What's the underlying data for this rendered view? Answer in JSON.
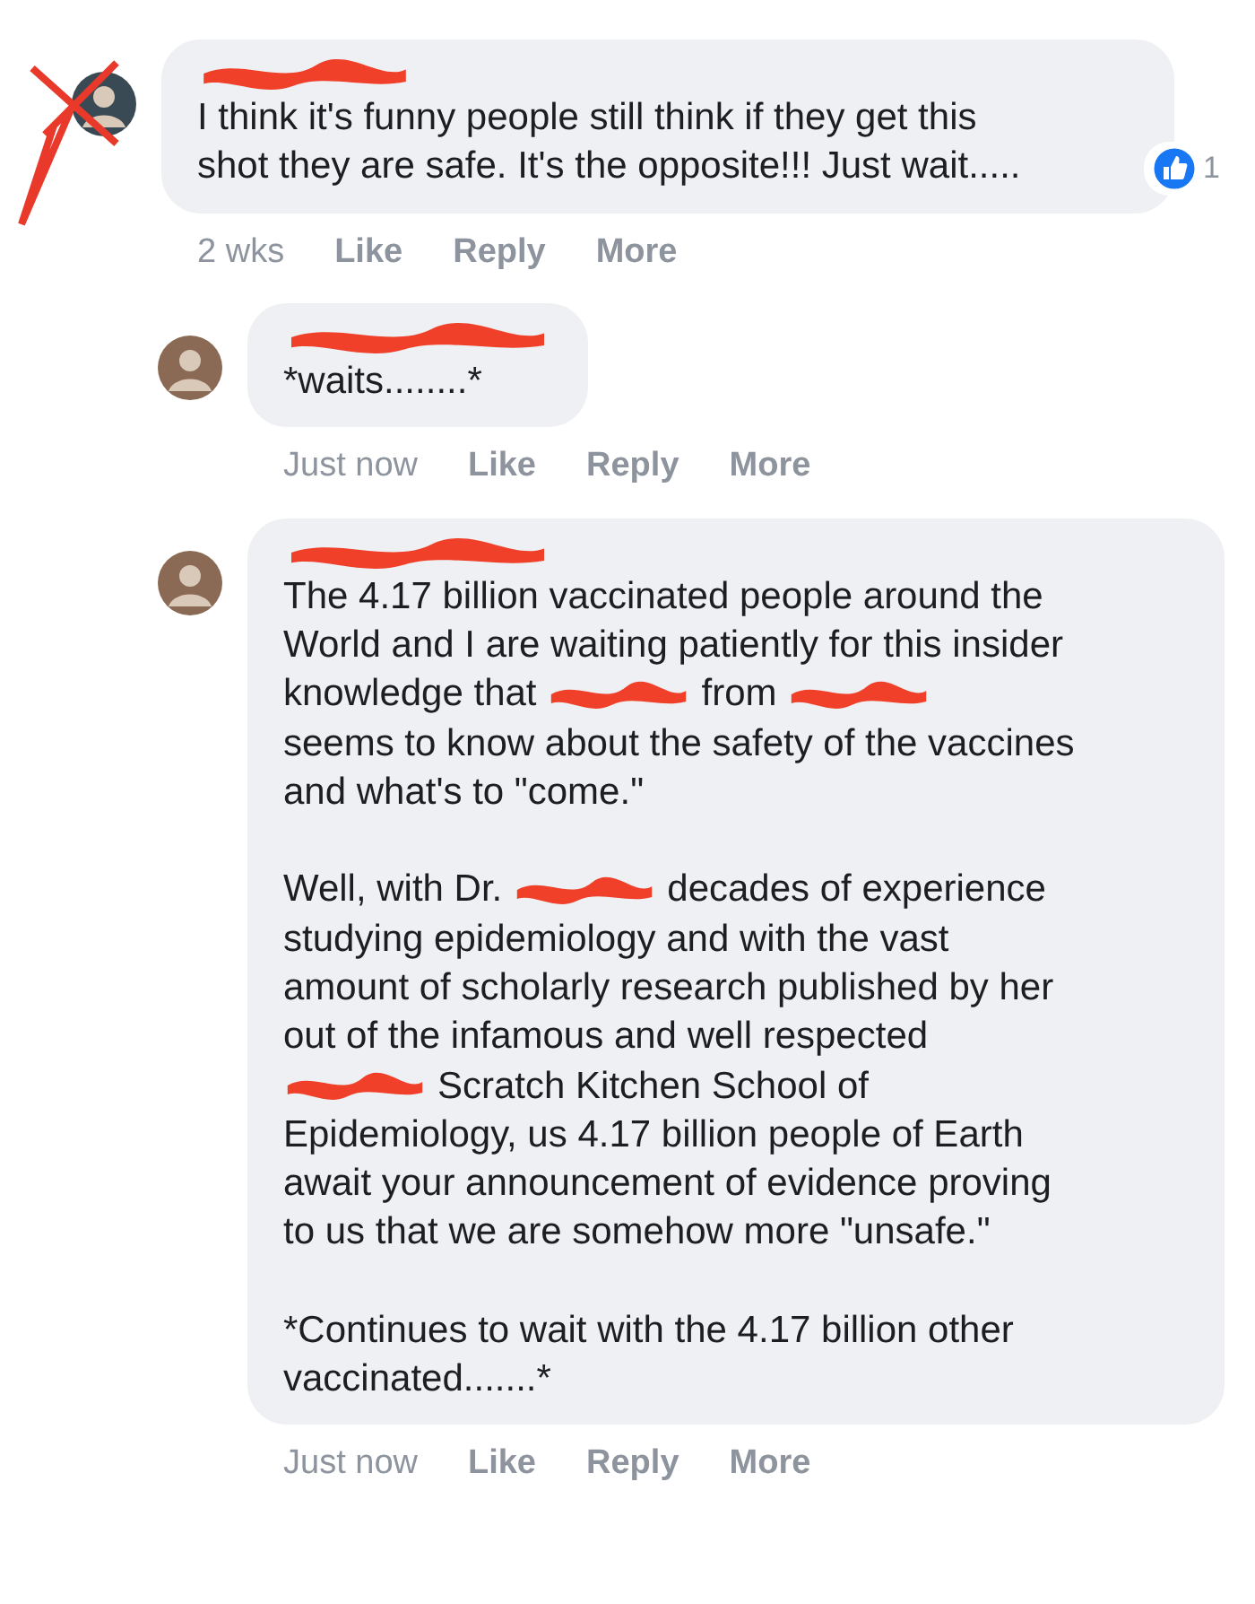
{
  "comments": [
    {
      "kind": "comment",
      "avatar_crossed": true,
      "paragraphs": [
        [
          [
            {
              "kind": "text",
              "text": "I think it's funny people still think if they get this"
            }
          ],
          [
            {
              "kind": "text",
              "text": "shot they are safe. It's the opposite!!! Just wait....."
            }
          ]
        ]
      ],
      "reactions": {
        "count": "1"
      },
      "time": "2 wks",
      "actions": [
        "Like",
        "Reply",
        "More"
      ]
    },
    {
      "kind": "reply",
      "avatar_crossed": false,
      "paragraphs": [
        [
          [
            {
              "kind": "text",
              "text": "*waits........*"
            }
          ]
        ]
      ],
      "time": "Just now",
      "actions": [
        "Like",
        "Reply",
        "More"
      ]
    },
    {
      "kind": "reply",
      "avatar_crossed": false,
      "paragraphs": [
        [
          [
            {
              "kind": "text",
              "text": "The 4.17 billion vaccinated people around the"
            }
          ],
          [
            {
              "kind": "text",
              "text": "World and I are waiting patiently for this insider"
            }
          ],
          [
            {
              "kind": "text",
              "text": "knowledge that"
            },
            {
              "kind": "redaction"
            },
            {
              "kind": "text",
              "text": "from"
            },
            {
              "kind": "redaction"
            }
          ],
          [
            {
              "kind": "text",
              "text": "seems to know about the safety of the vaccines"
            }
          ],
          [
            {
              "kind": "text",
              "text": "and what's to \"come.\""
            }
          ]
        ],
        [
          [
            {
              "kind": "text",
              "text": "Well, with Dr."
            },
            {
              "kind": "redaction"
            },
            {
              "kind": "text",
              "text": "decades of experience"
            }
          ],
          [
            {
              "kind": "text",
              "text": "studying epidemiology and with the vast"
            }
          ],
          [
            {
              "kind": "text",
              "text": "amount of scholarly research published by her"
            }
          ],
          [
            {
              "kind": "text",
              "text": "out of the infamous and well respected"
            }
          ],
          [
            {
              "kind": "redaction"
            },
            {
              "kind": "text",
              "text": "Scratch Kitchen School of"
            }
          ],
          [
            {
              "kind": "text",
              "text": "Epidemiology, us 4.17 billion people of Earth"
            }
          ],
          [
            {
              "kind": "text",
              "text": "await your announcement of evidence proving"
            }
          ],
          [
            {
              "kind": "text",
              "text": "to us that we are somehow more \"unsafe.\""
            }
          ]
        ],
        [
          [
            {
              "kind": "text",
              "text": "*Continues to wait with the 4.17 billion other"
            }
          ],
          [
            {
              "kind": "text",
              "text": "vaccinated.......*"
            }
          ]
        ]
      ],
      "time": "Just now",
      "actions": [
        "Like",
        "Reply",
        "More"
      ]
    }
  ]
}
